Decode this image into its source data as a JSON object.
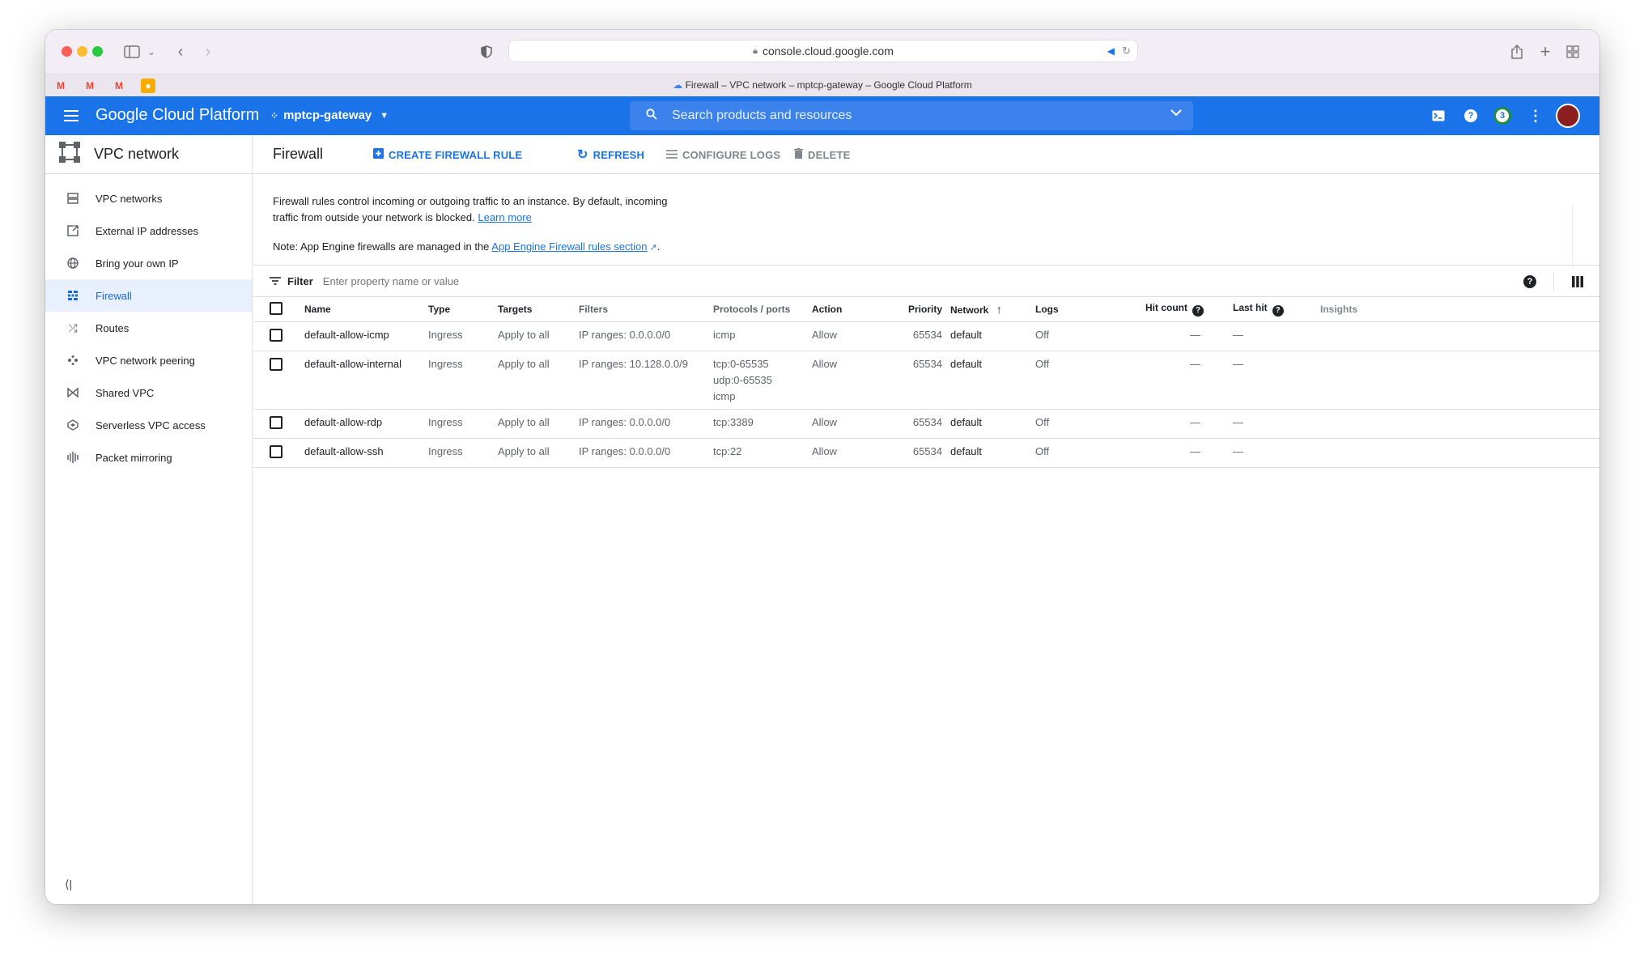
{
  "browser": {
    "url": "console.cloud.google.com",
    "tab_title": "Firewall – VPC network – mptcp-gateway – Google Cloud Platform"
  },
  "header": {
    "brand": "Google Cloud Platform",
    "project": "mptcp-gateway",
    "search_placeholder": "Search products and resources",
    "notifications_count": "3"
  },
  "nav": {
    "title": "VPC network",
    "items": [
      {
        "label": "VPC networks",
        "icon": "vpc-networks-icon"
      },
      {
        "label": "External IP addresses",
        "icon": "external-ip-icon"
      },
      {
        "label": "Bring your own IP",
        "icon": "globe-icon"
      },
      {
        "label": "Firewall",
        "icon": "firewall-icon",
        "active": true
      },
      {
        "label": "Routes",
        "icon": "routes-icon"
      },
      {
        "label": "VPC network peering",
        "icon": "peering-icon"
      },
      {
        "label": "Shared VPC",
        "icon": "shared-vpc-icon"
      },
      {
        "label": "Serverless VPC access",
        "icon": "serverless-icon"
      },
      {
        "label": "Packet mirroring",
        "icon": "packet-mirroring-icon"
      }
    ]
  },
  "toolbar": {
    "title": "Firewall",
    "create": "CREATE FIREWALL RULE",
    "refresh": "REFRESH",
    "configure_logs": "CONFIGURE LOGS",
    "delete": "DELETE"
  },
  "info": {
    "line1": "Firewall rules control incoming or outgoing traffic to an instance. By default, incoming",
    "line2": "traffic from outside your network is blocked.",
    "learn_more": "Learn more",
    "note_prefix": "Note: App Engine firewalls are managed in the",
    "note_link": "App Engine Firewall rules section",
    "note_suffix": "."
  },
  "filter": {
    "label": "Filter",
    "placeholder": "Enter property name or value"
  },
  "table": {
    "columns": [
      "Name",
      "Type",
      "Targets",
      "Filters",
      "Protocols / ports",
      "Action",
      "Priority",
      "Network",
      "Logs",
      "Hit count",
      "Last hit",
      "Insights"
    ],
    "rows": [
      {
        "name": "default-allow-icmp",
        "type": "Ingress",
        "targets": "Apply to all",
        "filters": "IP ranges: 0.0.0.0/0",
        "protocols": [
          "icmp"
        ],
        "action": "Allow",
        "priority": "65534",
        "network": "default",
        "logs": "Off",
        "hit_count": "—",
        "last_hit": "—"
      },
      {
        "name": "default-allow-internal",
        "type": "Ingress",
        "targets": "Apply to all",
        "filters": "IP ranges: 10.128.0.0/9",
        "protocols": [
          "tcp:0-65535",
          "udp:0-65535",
          "icmp"
        ],
        "action": "Allow",
        "priority": "65534",
        "network": "default",
        "logs": "Off",
        "hit_count": "—",
        "last_hit": "—"
      },
      {
        "name": "default-allow-rdp",
        "type": "Ingress",
        "targets": "Apply to all",
        "filters": "IP ranges: 0.0.0.0/0",
        "protocols": [
          "tcp:3389"
        ],
        "action": "Allow",
        "priority": "65534",
        "network": "default",
        "logs": "Off",
        "hit_count": "—",
        "last_hit": "—"
      },
      {
        "name": "default-allow-ssh",
        "type": "Ingress",
        "targets": "Apply to all",
        "filters": "IP ranges: 0.0.0.0/0",
        "protocols": [
          "tcp:22"
        ],
        "action": "Allow",
        "priority": "65534",
        "network": "default",
        "logs": "Off",
        "hit_count": "—",
        "last_hit": "—"
      }
    ]
  }
}
